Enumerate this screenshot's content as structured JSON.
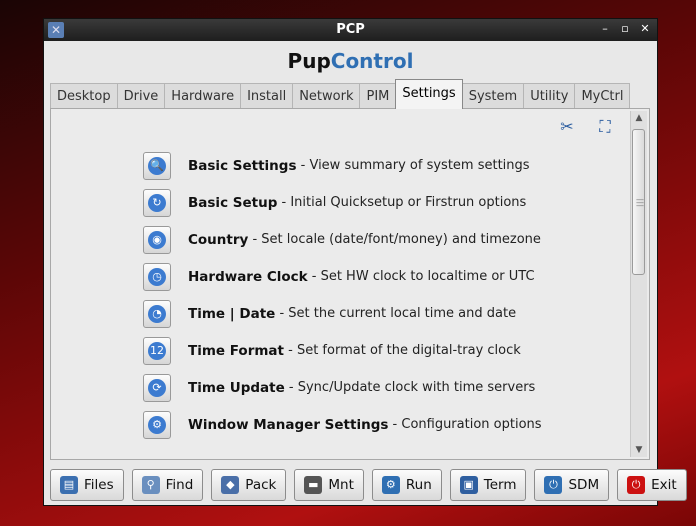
{
  "window": {
    "title": "PCP"
  },
  "brand": {
    "part1": "Pup",
    "part2": "Control"
  },
  "tabs": [
    {
      "label": "Desktop",
      "active": false
    },
    {
      "label": "Drive",
      "active": false
    },
    {
      "label": "Hardware",
      "active": false
    },
    {
      "label": "Install",
      "active": false
    },
    {
      "label": "Network",
      "active": false
    },
    {
      "label": "PIM",
      "active": false
    },
    {
      "label": "Settings",
      "active": true
    },
    {
      "label": "System",
      "active": false
    },
    {
      "label": "Utility",
      "active": false
    },
    {
      "label": "MyCtrl",
      "active": false
    }
  ],
  "items": [
    {
      "name": "Basic Settings",
      "desc": " - View summary of system settings",
      "icon": "magnifier-icon"
    },
    {
      "name": "Basic Setup",
      "desc": " - Initial Quicksetup or Firstrun options",
      "icon": "refresh-icon"
    },
    {
      "name": "Country",
      "desc": " - Set locale (date/font/money) and timezone",
      "icon": "globe-icon"
    },
    {
      "name": "Hardware Clock",
      "desc": " - Set HW clock to localtime or UTC",
      "icon": "clock-icon"
    },
    {
      "name": "Time | Date",
      "desc": " - Set the current local time and date",
      "icon": "time-date-icon"
    },
    {
      "name": "Time Format",
      "desc": " - Set format of the digital-tray clock",
      "icon": "digital-12-icon"
    },
    {
      "name": "Time Update",
      "desc": " - Sync/Update clock with time servers",
      "icon": "time-sync-icon"
    },
    {
      "name": "Window Manager Settings",
      "desc": " - Configuration options",
      "icon": "window-gear-icon"
    }
  ],
  "toolbar": [
    {
      "label": "Files",
      "icon": "files-icon",
      "color": "#3b6fb0",
      "glyph": "▤"
    },
    {
      "label": "Find",
      "icon": "find-icon",
      "color": "#6a8fbf",
      "glyph": "⚲"
    },
    {
      "label": "Pack",
      "icon": "pack-icon",
      "color": "#4a6fa8",
      "glyph": "◆"
    },
    {
      "label": "Mnt",
      "icon": "mount-icon",
      "color": "#555555",
      "glyph": "▬"
    },
    {
      "label": "Run",
      "icon": "run-icon",
      "color": "#2f6fb3",
      "glyph": "⚙"
    },
    {
      "label": "Term",
      "icon": "terminal-icon",
      "color": "#2f5fa0",
      "glyph": "▣"
    },
    {
      "label": "SDM",
      "icon": "sdm-icon",
      "color": "#2f6fb3",
      "glyph": "⏻"
    },
    {
      "label": "Exit",
      "icon": "exit-icon",
      "color": "#cc1111",
      "glyph": "⏻"
    }
  ]
}
